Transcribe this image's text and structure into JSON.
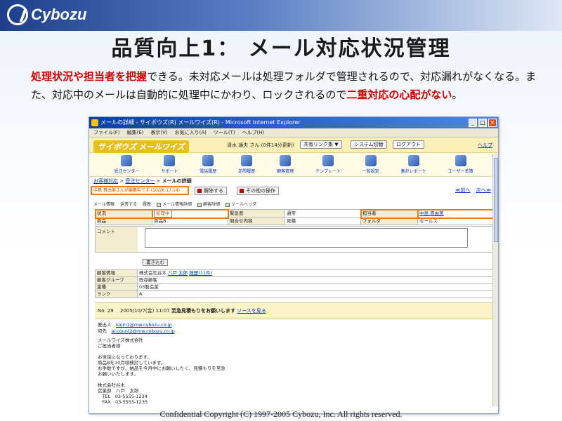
{
  "brand": {
    "logo_text": "Cybozu"
  },
  "slide": {
    "title": "品質向上1： メール対応状況管理",
    "desc": {
      "p1_red": "処理状況や担当者を把握",
      "p1": "できる。未対応メールは処理フォルダで管理されるので、対応漏れがなくなる。また、対応中のメールは自動的に処理中にかわり、ロックされるので",
      "p2_red": "二重対応の心配がない",
      "p3": "。"
    },
    "footer": "Confidential Copyright (C) 1997-2005 Cybozu, Inc. All rights reserved."
  },
  "window": {
    "title": "メールの詳細 - サイボウズ(R) メールワイズ(R) - Microsoft Internet Explorer",
    "menu": [
      "ファイル(F)",
      "編集(E)",
      "表示(V)",
      "お気に入り(A)",
      "ツール(T)",
      "ヘルプ(H)"
    ]
  },
  "app": {
    "brand": "サイボウズ メールワイズ",
    "user": "清水 通夫 さん (0件14分更新)",
    "buttons": {
      "share": "共有リンク集 ▼",
      "system": "システム切替",
      "logout": "ログアウト"
    },
    "help": "ヘルプ",
    "nav": [
      "受注センター",
      "サポート",
      "電話履歴",
      "訪問履歴",
      "顧客管理",
      "テンプレート",
      "一覧設定",
      "集計レポート",
      "ユーザー名簿"
    ],
    "crumb": {
      "a": "お客様対応",
      "b": "受注センター",
      "c": "メールの詳細"
    },
    "editing": "中島 貴由美さんが編集中です (10/26 17:14)",
    "btn_unlock": "解除する",
    "btn_other": "その他の操作",
    "pager": {
      "prev": "≪前へ",
      "next": "次へ≫"
    },
    "subtabs": [
      "メール情報",
      "返答する",
      "履歴",
      "メール情報詳細",
      "顧客詳細",
      "ツールヘッダ"
    ],
    "fields": {
      "status_l": "状況",
      "status_v": "処理中",
      "urgency_l": "緊急度",
      "urgency_v": "通常",
      "owner_l": "担当者",
      "owner_v": "中島 貴由美",
      "product_l": "商品",
      "product_v": "商品B",
      "inquiry_l": "問合せ内容",
      "inquiry_v": "見積",
      "folder_l": "フォルダ",
      "folder_v": "セールス",
      "comment_l": "コメント",
      "write": "書き込む"
    },
    "customer": {
      "info_l": "顧客情報",
      "company": "株式会社谷木",
      "person": "八戸 太郎",
      "history": "経歴(11件)",
      "group_l": "顧客グループ",
      "group_v": "既存顧客",
      "industry_l": "業種",
      "industry_v": "03製造業",
      "rank_l": "ランク",
      "rank_v": "A"
    },
    "mail": {
      "no": "No. 29",
      "date": "2005/10/7(金) 11:07",
      "subject": "至急見積もりをお願いします",
      "source": "ソースを見る",
      "from_l": "差出人",
      "from_v": "kojin1@mw.cybozu.co.jp",
      "to_l": "宛先",
      "to_v": "account2@mw.cybozu.co.jp",
      "body": "メールワイズ株式会社\nご担当者様\n\nお世話になっております。\n商品Bを10月頃検討しています。\nお手数ですが、納品を今月中にお願いしたく、見積もりを至急\nお願いいたします。\n\n株式会社谷木\n営業部　八戸　太郎\n　TEL　03-5555-1234\n　FAX　03-5555-1235"
    }
  }
}
